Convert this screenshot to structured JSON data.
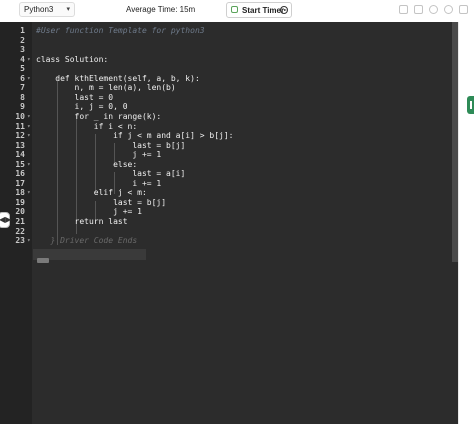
{
  "toolbar": {
    "language": "Python3",
    "average_time": "Average Time: 15m",
    "start_timer": "Start Timer",
    "icons": [
      "copy-icon",
      "copy-icon",
      "settings-icon",
      "refresh-icon",
      "expand-icon"
    ]
  },
  "editor": {
    "lines": [
      {
        "num": "1",
        "text": "#User function Template for python3",
        "kind": "comment"
      },
      {
        "num": "2",
        "text": "",
        "kind": "code"
      },
      {
        "num": "3",
        "text": "",
        "kind": "code"
      },
      {
        "num": "4",
        "text": "class Solution:",
        "kind": "code"
      },
      {
        "num": "5",
        "text": "",
        "kind": "code"
      },
      {
        "num": "6",
        "text": "    def kthElement(self, a, b, k):",
        "kind": "code"
      },
      {
        "num": "7",
        "text": "        n, m = len(a), len(b)",
        "kind": "code"
      },
      {
        "num": "8",
        "text": "        last = 0",
        "kind": "code"
      },
      {
        "num": "9",
        "text": "        i, j = 0, 0",
        "kind": "code"
      },
      {
        "num": "10",
        "text": "        for _ in range(k):",
        "kind": "code"
      },
      {
        "num": "11",
        "text": "            if i < n:",
        "kind": "code"
      },
      {
        "num": "12",
        "text": "                if j < m and a[i] > b[j]:",
        "kind": "code"
      },
      {
        "num": "13",
        "text": "                    last = b[j]",
        "kind": "code"
      },
      {
        "num": "14",
        "text": "                    j += 1",
        "kind": "code"
      },
      {
        "num": "15",
        "text": "                else:",
        "kind": "code"
      },
      {
        "num": "16",
        "text": "                    last = a[i]",
        "kind": "code"
      },
      {
        "num": "17",
        "text": "                    i += 1",
        "kind": "code"
      },
      {
        "num": "18",
        "text": "            elif j < m:",
        "kind": "code"
      },
      {
        "num": "19",
        "text": "                last = b[j]",
        "kind": "code"
      },
      {
        "num": "20",
        "text": "                j += 1",
        "kind": "code"
      },
      {
        "num": "21",
        "text": "        return last",
        "kind": "code"
      },
      {
        "num": "22",
        "text": "",
        "kind": "code"
      },
      {
        "num": "23",
        "text": "   } Driver Code Ends",
        "kind": "folded"
      }
    ],
    "fold_lines": [
      "4",
      "6",
      "10",
      "11",
      "12",
      "15",
      "18",
      "23"
    ]
  },
  "splitter_glyph": "◀▶"
}
